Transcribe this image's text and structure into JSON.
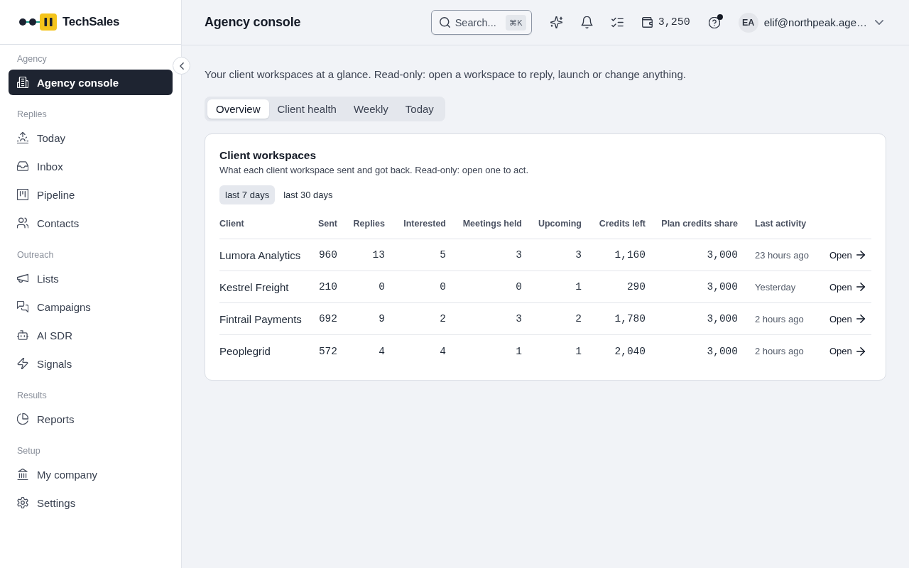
{
  "sidebar": {
    "brand": "TechSales",
    "sections": [
      {
        "label": "Agency",
        "items": [
          {
            "label": "Agency console",
            "selected": true
          }
        ]
      },
      {
        "label": "Replies",
        "items": [
          {
            "label": "Today",
            "selected": false
          },
          {
            "label": "Inbox",
            "selected": false
          },
          {
            "label": "Pipeline",
            "selected": false
          },
          {
            "label": "Contacts",
            "selected": false
          }
        ]
      },
      {
        "label": "Outreach",
        "items": [
          {
            "label": "Lists",
            "selected": false
          },
          {
            "label": "Campaigns",
            "selected": false
          },
          {
            "label": "AI SDR",
            "selected": false
          },
          {
            "label": "Signals",
            "selected": false
          }
        ]
      },
      {
        "label": "Results",
        "items": [
          {
            "label": "Reports",
            "selected": false
          }
        ]
      },
      {
        "label": "Setup",
        "items": [
          {
            "label": "My company",
            "selected": false
          },
          {
            "label": "Settings",
            "selected": false
          }
        ]
      }
    ]
  },
  "header": {
    "title": "Agency console",
    "search": {
      "placeholder": "Search...",
      "shortcut": "⌘K"
    },
    "credits": "3,250",
    "help": {
      "unread": true
    },
    "user": {
      "initials": "EA",
      "email": "elif@northpeak.age…"
    }
  },
  "intro": "Your client workspaces at a glance. Read-only: open a workspace to reply, launch or change anything.",
  "tabs": [
    {
      "label": "Overview",
      "selected": true
    },
    {
      "label": "Client health",
      "selected": false
    },
    {
      "label": "Weekly",
      "selected": false
    },
    {
      "label": "Today",
      "selected": false
    }
  ],
  "workspaces": {
    "title": "Client workspaces",
    "subtitle": "What each client workspace sent and got back. Read-only: open one to act.",
    "periods": [
      {
        "label": "last 7 days",
        "selected": true
      },
      {
        "label": "last 30 days",
        "selected": false
      }
    ],
    "table": {
      "columns": [
        {
          "label": "Client",
          "kind": "name"
        },
        {
          "label": "Sent",
          "kind": "number"
        },
        {
          "label": "Replies",
          "kind": "number"
        },
        {
          "label": "Interested",
          "kind": "number"
        },
        {
          "label": "Meetings held",
          "kind": "number"
        },
        {
          "label": "Upcoming",
          "kind": "number"
        },
        {
          "label": "Credits left",
          "kind": "number"
        },
        {
          "label": "Plan credits share",
          "kind": "number"
        },
        {
          "label": "Last activity",
          "kind": "time"
        }
      ],
      "rows": [
        {
          "cells": [
            "Lumora Analytics",
            "960",
            "13",
            "5",
            "3",
            "3",
            "1,160",
            "3,000",
            "23 hours ago"
          ],
          "action": "Open"
        },
        {
          "cells": [
            "Kestrel Freight",
            "210",
            "0",
            "0",
            "0",
            "1",
            "290",
            "3,000",
            "Yesterday"
          ],
          "action": "Open"
        },
        {
          "cells": [
            "Fintrail Payments",
            "692",
            "9",
            "2",
            "3",
            "2",
            "1,780",
            "3,000",
            "2 hours ago"
          ],
          "action": "Open"
        },
        {
          "cells": [
            "Peoplegrid",
            "572",
            "4",
            "4",
            "1",
            "1",
            "2,040",
            "3,000",
            "2 hours ago"
          ],
          "action": "Open"
        }
      ]
    }
  }
}
